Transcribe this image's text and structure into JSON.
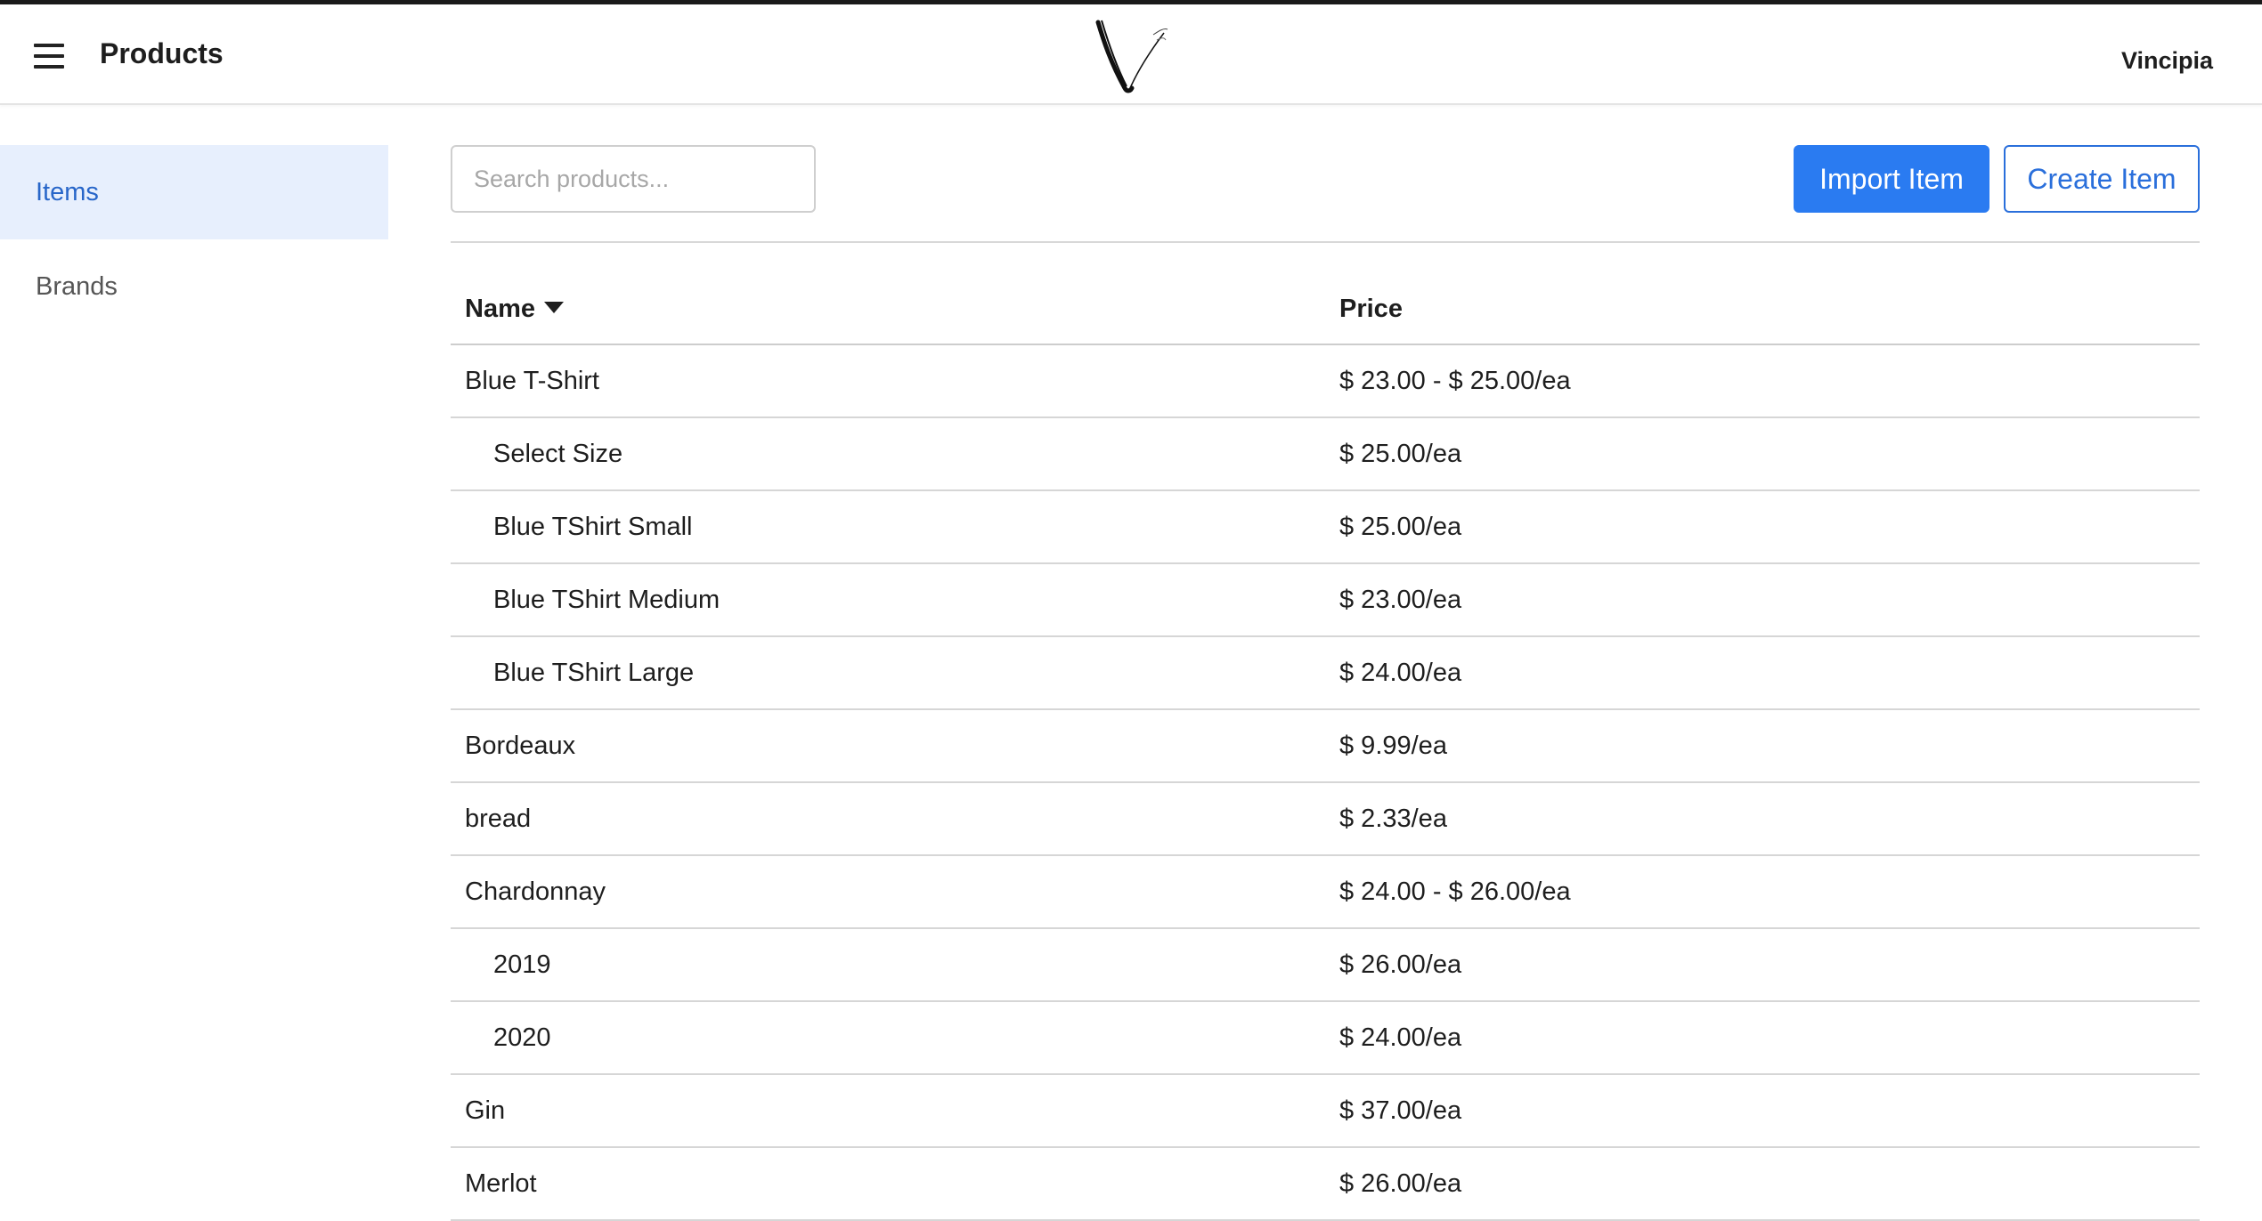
{
  "header": {
    "title": "Products",
    "org_name": "Vincipia"
  },
  "sidebar": {
    "items": [
      {
        "label": "Items",
        "active": true
      },
      {
        "label": "Brands",
        "active": false
      }
    ]
  },
  "toolbar": {
    "search_placeholder": "Search products...",
    "import_label": "Import Item",
    "create_label": "Create Item"
  },
  "table": {
    "columns": [
      "Name",
      "Price"
    ],
    "sort_icon": "caret-down-icon",
    "rows": [
      {
        "name": "Blue T-Shirt",
        "price": "$ 23.00 - $ 25.00/ea",
        "child": false
      },
      {
        "name": "Select Size",
        "price": "$ 25.00/ea",
        "child": true
      },
      {
        "name": "Blue TShirt Small",
        "price": "$ 25.00/ea",
        "child": true
      },
      {
        "name": "Blue TShirt Medium",
        "price": "$ 23.00/ea",
        "child": true
      },
      {
        "name": "Blue TShirt Large",
        "price": "$ 24.00/ea",
        "child": true
      },
      {
        "name": "Bordeaux",
        "price": "$ 9.99/ea",
        "child": false
      },
      {
        "name": "bread",
        "price": "$ 2.33/ea",
        "child": false
      },
      {
        "name": "Chardonnay",
        "price": "$ 24.00 - $ 26.00/ea",
        "child": false
      },
      {
        "name": "2019",
        "price": "$ 26.00/ea",
        "child": true
      },
      {
        "name": "2020",
        "price": "$ 24.00/ea",
        "child": true
      },
      {
        "name": "Gin",
        "price": "$ 37.00/ea",
        "child": false
      },
      {
        "name": "Merlot",
        "price": "$ 26.00/ea",
        "child": false
      }
    ]
  },
  "colors": {
    "accent": "#2a7bf1",
    "active_bg": "#e7effd",
    "active_text": "#2866c9"
  }
}
